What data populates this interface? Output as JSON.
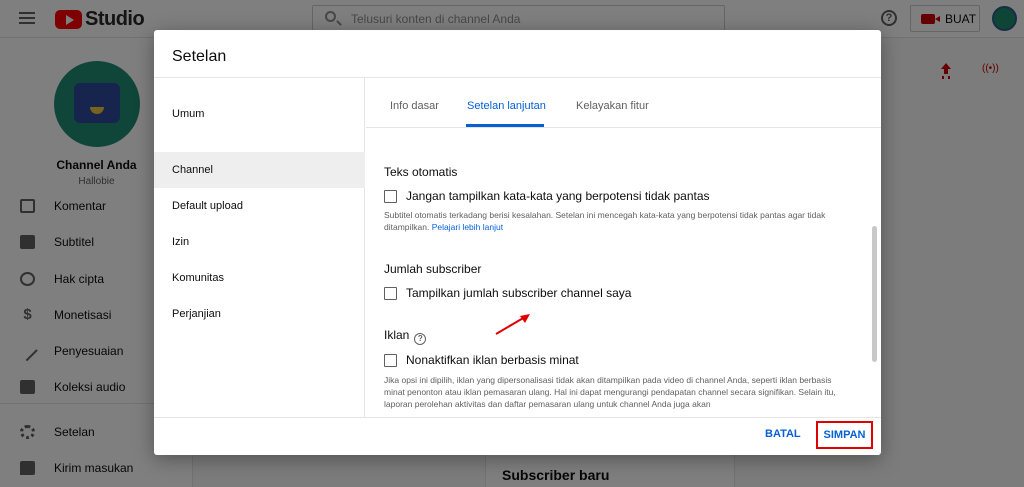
{
  "app": {
    "logo_text": "Studio",
    "search_placeholder": "Telusuri konten di channel Anda",
    "create_label": "BUAT",
    "help_glyph": "?"
  },
  "sidebar": {
    "channel_name": "Channel Anda",
    "channel_handle": "Hallobie",
    "items": [
      {
        "label": "Komentar",
        "icon": "comment-icon"
      },
      {
        "label": "Subtitel",
        "icon": "subtitles-icon"
      },
      {
        "label": "Hak cipta",
        "icon": "copyright-icon"
      },
      {
        "label": "Monetisasi",
        "icon": "dollar-icon"
      },
      {
        "label": "Penyesuaian",
        "icon": "magic-wand-icon"
      },
      {
        "label": "Koleksi audio",
        "icon": "audio-library-icon"
      },
      {
        "label": "Setelan",
        "icon": "gear-icon"
      },
      {
        "label": "Kirim masukan",
        "icon": "feedback-icon"
      }
    ]
  },
  "main": {
    "card_title": "Subscriber baru"
  },
  "dialog": {
    "title": "Setelan",
    "nav": [
      {
        "label": "Umum",
        "active": false
      },
      {
        "label": "Channel",
        "active": true
      },
      {
        "label": "Default upload",
        "active": false
      },
      {
        "label": "Izin",
        "active": false
      },
      {
        "label": "Komunitas",
        "active": false
      },
      {
        "label": "Perjanjian",
        "active": false
      }
    ],
    "tabs": [
      {
        "label": "Info dasar",
        "active": false
      },
      {
        "label": "Setelan lanjutan",
        "active": true
      },
      {
        "label": "Kelayakan fitur",
        "active": false
      }
    ],
    "sections": {
      "auto_captions": {
        "title": "Teks otomatis",
        "checkbox_label": "Jangan tampilkan kata-kata yang berpotensi tidak pantas",
        "checked": false,
        "help_text": "Subtitel otomatis terkadang berisi kesalahan. Setelan ini mencegah kata-kata yang berpotensi tidak pantas agar tidak ditampilkan.",
        "help_link": "Pelajari lebih lanjut"
      },
      "subscriber_count": {
        "title": "Jumlah subscriber",
        "checkbox_label": "Tampilkan jumlah subscriber channel saya",
        "checked": false
      },
      "ads": {
        "title": "Iklan",
        "info_glyph": "?",
        "checkbox_label": "Nonaktifkan iklan berbasis minat",
        "checked": false,
        "help_text": "Jika opsi ini dipilih, iklan yang dipersonalisasi tidak akan ditampilkan pada video di channel Anda, seperti iklan berbasis minat penonton atau iklan pemasaran ulang. Hal ini dapat mengurangi pendapatan channel secara signifikan. Selain itu, laporan perolehan aktivitas dan daftar pemasaran ulang untuk channel Anda juga akan"
      }
    },
    "cancel_label": "BATAL",
    "save_label": "SIMPAN",
    "colors": {
      "accent": "#065fd4",
      "highlight_box": "#e00000",
      "annotation_arrow": "#e00000"
    }
  }
}
